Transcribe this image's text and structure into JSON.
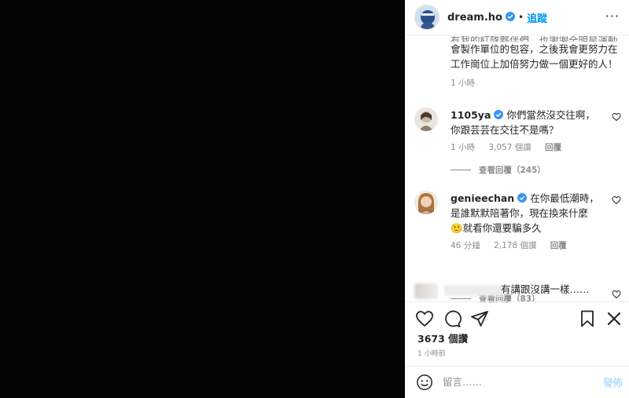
{
  "post": {
    "username": "dream.ho",
    "separator": "•",
    "follow_label": "追蹤",
    "more_label": "···",
    "caption_faded": "有我的紅隊夥伴們，也謝謝全明星運動",
    "caption_lines": [
      "會製作單位的包容，之後我會更努力在",
      "工作崗位上加倍努力做一個更好的人！"
    ],
    "caption_time": "1 小時"
  },
  "comments": [
    {
      "username": "1105ya",
      "text": "你們當然沒交往啊，你跟芸芸在交往不是嗎？",
      "time": "1 小時",
      "likes": "3,057 個讚",
      "reply_label": "回覆",
      "view_replies": "查看回覆（245）"
    },
    {
      "username": "genieechan",
      "text": "在你最低潮時，是誰默默陪著你，現在換來什麼",
      "emoji": "🙂",
      "text_tail": "就看你還要騙多久",
      "time": "46 分鐘",
      "likes": "2,178 個讚",
      "reply_label": "回覆",
      "view_replies": "查看回覆（83）"
    },
    {
      "text": "有講跟沒講一樣……"
    }
  ],
  "actions": {
    "icons": [
      "heart-icon",
      "comment-icon",
      "share-icon",
      "bookmark-icon"
    ]
  },
  "likes_count": "3673 個讚",
  "posted_time": "1 小時前",
  "composer": {
    "placeholder": "留言……",
    "post_label": "發佈"
  },
  "colors": {
    "accent": "#0095f6",
    "post_disabled": "#b2dffc",
    "media_bg": "#050505"
  }
}
